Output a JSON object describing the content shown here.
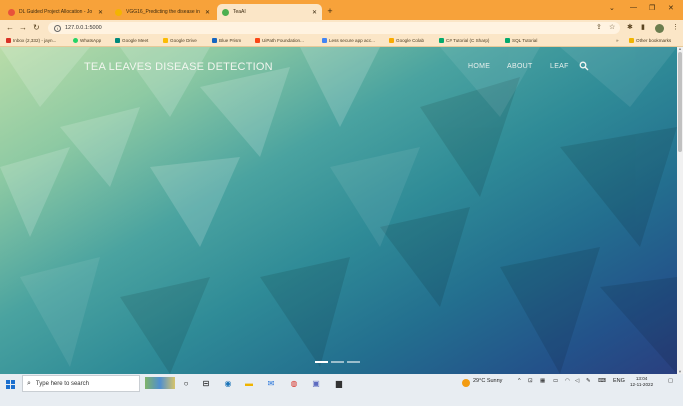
{
  "browser": {
    "tabs": [
      {
        "title": "DL Guided Project Allocation - Jo",
        "active": false,
        "favicon_color": "#e8523a"
      },
      {
        "title": "VGG16_Predicting the disease in",
        "active": false,
        "favicon_color": "#f4b400"
      },
      {
        "title": "TeaAI",
        "active": true,
        "favicon_color": "#4caf50"
      }
    ],
    "new_tab_symbol": "+",
    "window_controls": {
      "collapse": "⌄",
      "minimize": "—",
      "maximize": "❐",
      "close": "✕"
    },
    "address": {
      "url": "127.0.0.1:5000"
    },
    "bookmarks": [
      {
        "label": "Inbox (2,332) - jayn...",
        "color": "#d93025"
      },
      {
        "label": "WhatsApp",
        "color": "#25d366"
      },
      {
        "label": "Google Meet",
        "color": "#00897b"
      },
      {
        "label": "Google Drive",
        "color": "#fbbc04"
      },
      {
        "label": "Blue Prism",
        "color": "#1565c0"
      },
      {
        "label": "UiPath Foundation...",
        "color": "#fa4616"
      },
      {
        "label": "Less secure app acc...",
        "color": "#4285f4"
      },
      {
        "label": "Google Colab",
        "color": "#f9ab00"
      },
      {
        "label": "C# Tutorial (C Sharp)",
        "color": "#04aa6d"
      },
      {
        "label": "SQL Tutorial",
        "color": "#04aa6d"
      }
    ],
    "bookmarks_more": "»",
    "other_bookmarks": "Other bookmarks"
  },
  "site": {
    "brand": "TEA LEAVES DISEASE DETECTION",
    "nav": [
      {
        "label": "HOME"
      },
      {
        "label": "ABOUT"
      },
      {
        "label": "LEAF"
      }
    ],
    "carousel_slides": 3,
    "carousel_active": 1,
    "accent_colors": [
      "#b9dca8",
      "#4aa3a0",
      "#236f8f",
      "#2a3f7f"
    ]
  },
  "taskbar": {
    "search_placeholder": "Type here to search",
    "weather": "29°C  Sunny",
    "language": "ENG",
    "time": "13:04",
    "date": "12-11-2022"
  }
}
